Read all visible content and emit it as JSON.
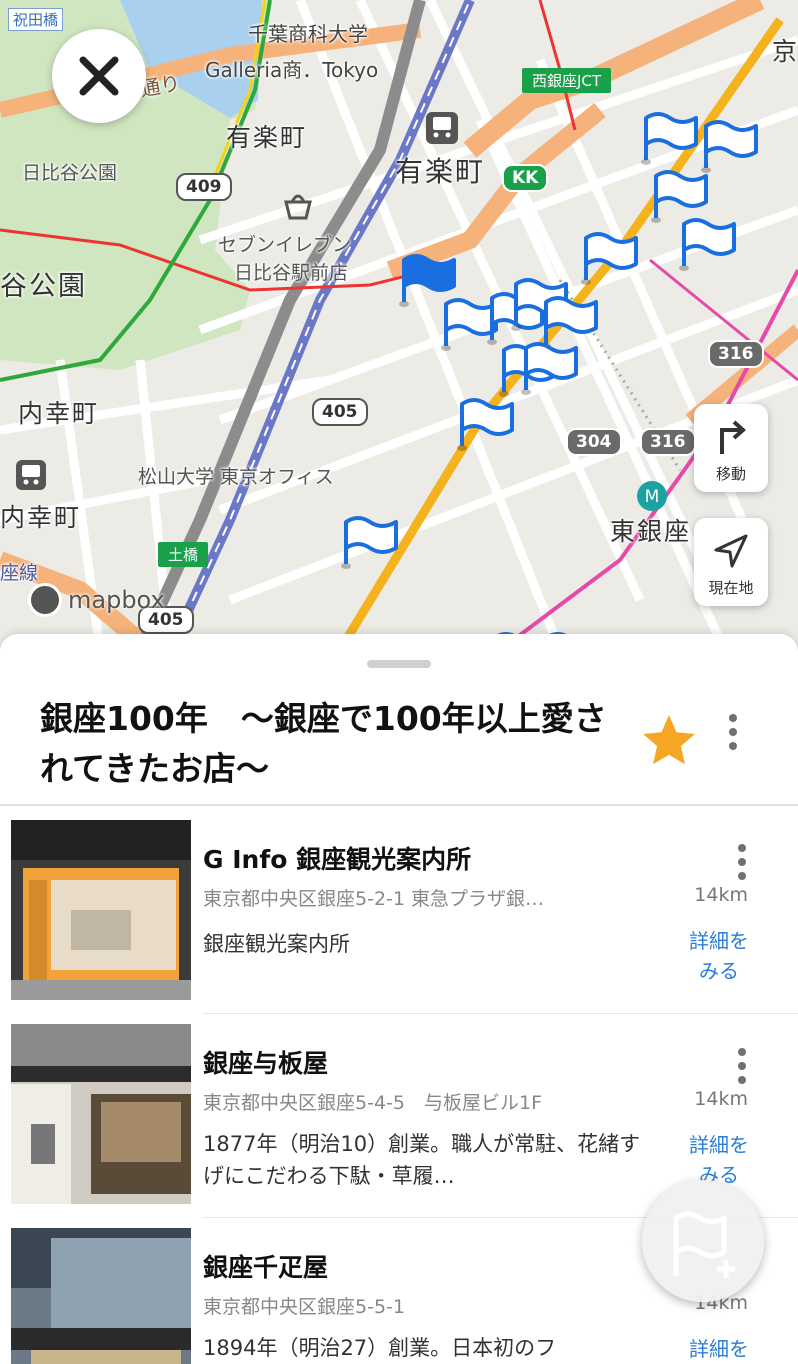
{
  "map": {
    "labels": {
      "hibiya_bridge": "祝田橋",
      "chiba_univ": "千葉商科大学",
      "galleria": "Galleria商．Tokyo",
      "yurakucho_area": "有楽町",
      "yurakucho_station": "有楽町",
      "hibiya_park": "日比谷公園",
      "park_large": "谷公園",
      "seven_eleven": "セブンイレブン",
      "seven_eleven_branch": "日比谷駅前店",
      "uchisaiwaicho_area": "内幸町",
      "uchisaiwaicho_station": "内幸町",
      "matsuyama": "松山大学 東京オフィス",
      "higashi_ginza": "東銀座",
      "doori": "通り",
      "sen": "座線",
      "kyo": "京"
    },
    "routes": {
      "r409": "409",
      "r405a": "405",
      "r405b": "405",
      "r304": "304",
      "r316a": "316",
      "r316b": "316",
      "kk": "KK"
    },
    "junctions": {
      "nishiginza": "西銀座JCT",
      "dobashi": "土橋"
    },
    "attribution": "mapbox",
    "buttons": {
      "move": "移動",
      "current": "現在地"
    }
  },
  "list": {
    "title": "銀座100年　～銀座で100年以上愛されてきたお店～",
    "favorited": true,
    "items": [
      {
        "name": "G Info 銀座観光案内所",
        "address": "東京都中央区銀座5-2-1 東急プラザ銀…",
        "distance": "14km",
        "description": "銀座観光案内所",
        "detail": "詳細をみる"
      },
      {
        "name": "銀座与板屋",
        "address": "東京都中央区銀座5-4-5　与板屋ビル1F",
        "distance": "14km",
        "description": "1877年（明治10）創業。職人が常駐、花緒すげにこだわる下駄・草履…",
        "detail": "詳細をみる"
      },
      {
        "name": "銀座千疋屋",
        "address": "東京都中央区銀座5-5-1",
        "distance": "14km",
        "description": "1894年（明治27）創業。日本初のフ",
        "detail": "詳細を"
      }
    ]
  },
  "colors": {
    "accent": "#2a7fd4",
    "flag": "#1a6fe0",
    "star": "#f6a623",
    "metro_green": "#19a14a"
  },
  "icons": [
    "close-icon",
    "turn-right-icon",
    "navigation-arrow-icon",
    "star-icon",
    "more-vertical-icon",
    "flag-add-icon",
    "train-icon",
    "basket-icon",
    "metro-icon",
    "flag-icon"
  ]
}
